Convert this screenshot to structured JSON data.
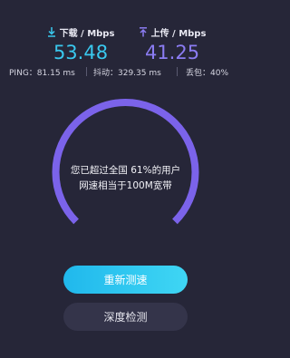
{
  "download": {
    "label": "下载 / Mbps",
    "value": "53.48",
    "icon": "download-icon",
    "color": "#39c8ee"
  },
  "upload": {
    "label": "上传 / Mbps",
    "value": "41.25",
    "icon": "upload-icon",
    "color": "#8b7cf2"
  },
  "stats": {
    "ping": "PING：81.15 ms",
    "jitter": "抖动：329.35 ms",
    "loss": "丢包：40%"
  },
  "gauge": {
    "line1": "您已超过全国 61%的用户",
    "line2": "网速相当于100M宽带",
    "percentile": 61,
    "arc_color": "#7b63ea",
    "track_color": "#3a3a52"
  },
  "buttons": {
    "retest": "重新测速",
    "deep_check": "深度检测"
  }
}
